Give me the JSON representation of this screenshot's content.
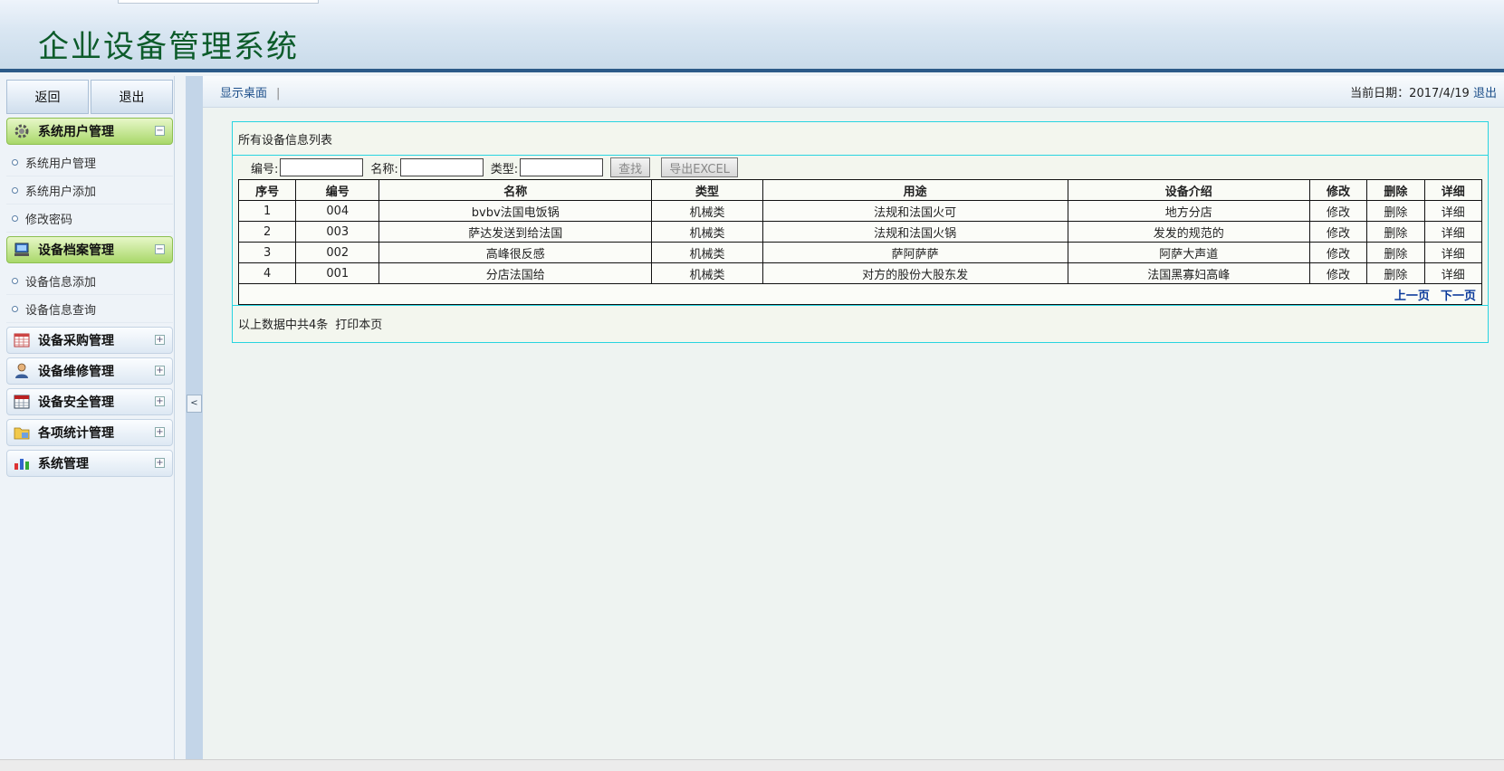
{
  "header": {
    "title": "企业设备管理系统"
  },
  "sidebar": {
    "buttons": {
      "back": "返回",
      "logout": "退出"
    },
    "groups": [
      {
        "label": "系统用户管理",
        "icon": "gear-icon",
        "open": true,
        "items": [
          "系统用户管理",
          "系统用户添加",
          "修改密码"
        ]
      },
      {
        "label": "设备档案管理",
        "icon": "monitor-icon",
        "open": true,
        "items": [
          "设备信息添加",
          "设备信息查询"
        ]
      },
      {
        "label": "设备采购管理",
        "icon": "spreadsheet-icon",
        "open": false
      },
      {
        "label": "设备维修管理",
        "icon": "user-icon",
        "open": false
      },
      {
        "label": "设备安全管理",
        "icon": "calendar-icon",
        "open": false
      },
      {
        "label": "各项统计管理",
        "icon": "folder-icon",
        "open": false
      },
      {
        "label": "系统管理",
        "icon": "bar-chart-icon",
        "open": false
      }
    ],
    "toggle_minus": "−",
    "toggle_plus": "+"
  },
  "topbar": {
    "desktop_link": "显示桌面",
    "separator": "|",
    "date_label": "当前日期：2017/4/19",
    "logout_link": "退出"
  },
  "panel": {
    "title": "所有设备信息列表",
    "search": {
      "code_label": "编号:",
      "name_label": "名称:",
      "type_label": "类型:",
      "search_button": "查找",
      "export_button": "导出EXCEL"
    },
    "table": {
      "headers": [
        "序号",
        "编号",
        "名称",
        "类型",
        "用途",
        "设备介绍",
        "修改",
        "删除",
        "详细"
      ],
      "rows": [
        [
          "1",
          "004",
          "bvbv法国电饭锅",
          "机械类",
          "法规和法国火可",
          "地方分店",
          "修改",
          "删除",
          "详细"
        ],
        [
          "2",
          "003",
          "萨达发送到给法国",
          "机械类",
          "法规和法国火锅",
          "发发的规范的",
          "修改",
          "删除",
          "详细"
        ],
        [
          "3",
          "002",
          "高峰很反感",
          "机械类",
          "萨阿萨萨",
          "阿萨大声道",
          "修改",
          "删除",
          "详细"
        ],
        [
          "4",
          "001",
          "分店法国给",
          "机械类",
          "对方的股份大股东发",
          "法国黑寡妇高峰",
          "修改",
          "删除",
          "详细"
        ]
      ]
    },
    "pager": {
      "prev": "上一页",
      "next": "下一页"
    },
    "footer": {
      "summary": "以上数据中共4条",
      "print": "打印本页"
    }
  },
  "splitter": {
    "collapse_glyph": "<"
  }
}
